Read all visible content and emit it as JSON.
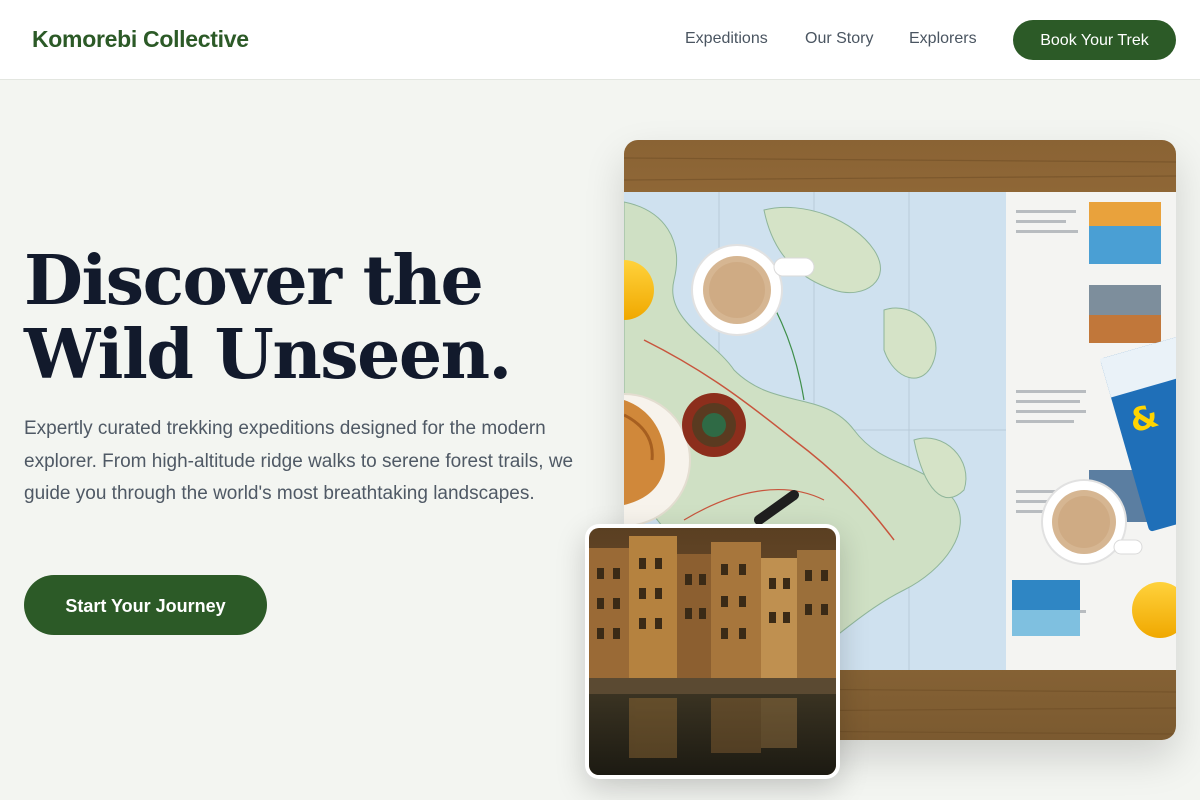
{
  "header": {
    "brand": "Komorebi Collective",
    "nav": [
      "Expeditions",
      "Our Story",
      "Explorers"
    ],
    "cta": "Book Your Trek"
  },
  "hero": {
    "title_line1": "Discover the",
    "title_line2": "Wild Unseen.",
    "description": "Expertly curated trekking expeditions designed for the modern explorer. From high-altitude ridge walks to serene forest trails, we guide you through the world's most breathtaking landscapes.",
    "cta": "Start Your Journey"
  },
  "images": {
    "main": "travel-map-table-photo",
    "secondary": "riverside-city-buildings-photo"
  },
  "colors": {
    "brand_green": "#2c5a27",
    "heading": "#121a2c",
    "body_text": "#4f5965",
    "page_bg": "#f3f5f1"
  }
}
